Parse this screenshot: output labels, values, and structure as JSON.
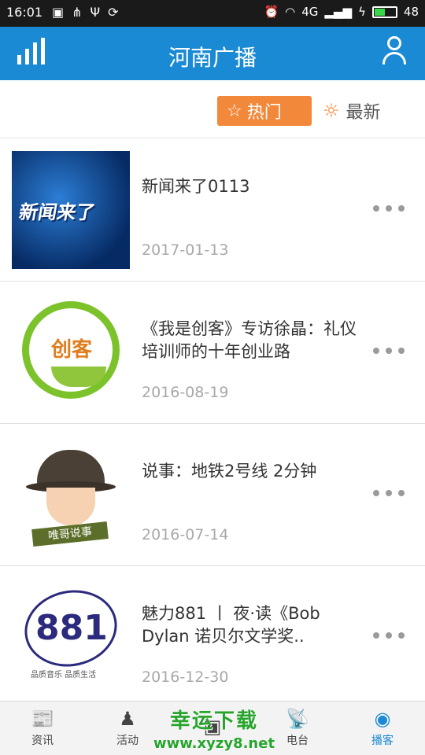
{
  "status_bar": {
    "time": "16:01",
    "left_icons": [
      "image-icon",
      "usb-share-icon",
      "usb-icon",
      "sync-icon"
    ],
    "network": "4G",
    "battery_level": 48,
    "battery_text": "48",
    "battery_color": "#3bd64a"
  },
  "app_bar": {
    "title": "河南广播",
    "left_icon": "signal-bars-icon",
    "right_icon": "user-icon",
    "color": "#1a8ad4"
  },
  "filters": {
    "hot_label": "热门",
    "new_label": "最新",
    "hot_color": "#f2883a"
  },
  "items": [
    {
      "title": "新闻来了0113",
      "date": "2017-01-13",
      "thumb_text": "新闻来了"
    },
    {
      "title": "《我是创客》专访徐晶：礼仪培训师的十年创业路",
      "date": "2016-08-19",
      "thumb_text": "创客"
    },
    {
      "title": "说事：地铁2号线 2分钟",
      "date": "2016-07-14",
      "thumb_text": "唯哥说事"
    },
    {
      "title": "魅力881 丨 夜·读《Bob Dylan 诺贝尔文学奖..",
      "date": "2016-12-30",
      "thumb_text": "881",
      "thumb_tag": "品质音乐 品质生活"
    }
  ],
  "bottom_nav": [
    {
      "label": "资讯",
      "icon": "news-icon",
      "glyph": "📰"
    },
    {
      "label": "活动",
      "icon": "activity-icon",
      "glyph": "♟"
    },
    {
      "label": "",
      "icon": "phone-icon",
      "glyph": "▣"
    },
    {
      "label": "电台",
      "icon": "radio-tower-icon",
      "glyph": "📡"
    },
    {
      "label": "播客",
      "icon": "podcast-icon",
      "glyph": "◉"
    }
  ],
  "watermark": {
    "title": "幸运下载",
    "url": "www.xyzy8.net"
  }
}
